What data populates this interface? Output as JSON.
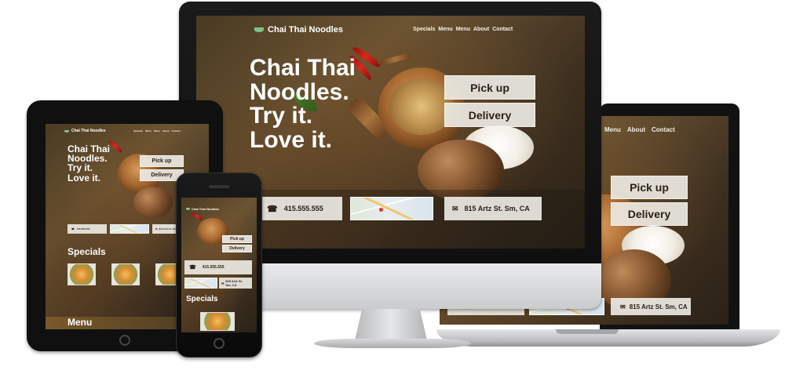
{
  "brand": {
    "name": "Chai Thai Noodles",
    "accent": "#7ec48a"
  },
  "nav": {
    "items": [
      "Specials",
      "Menu",
      "Menu",
      "About",
      "Contact"
    ],
    "laptop_items": [
      "Menu",
      "About",
      "Contact"
    ]
  },
  "hero": {
    "line1": "Chai Thai",
    "line2": "Noodles.",
    "line3": "Try it.",
    "line4": "Love it."
  },
  "cta": {
    "pickup": "Pick up",
    "delivery": "Delivery"
  },
  "info": {
    "phone": "415.555.555",
    "address": "815 Artz St. Sm, CA",
    "address_mobile_1": "815 Artz St.",
    "address_mobile_2": "Sm, CA"
  },
  "sections": {
    "specials": "Specials",
    "menu": "Menu"
  },
  "icons": {
    "phone": "phone-icon",
    "envelope": "envelope-icon",
    "logo": "bowl-icon"
  },
  "colors": {
    "button_bg": "#ebe8e2",
    "text_dark": "#2b2118",
    "background": "#4a3a22"
  }
}
